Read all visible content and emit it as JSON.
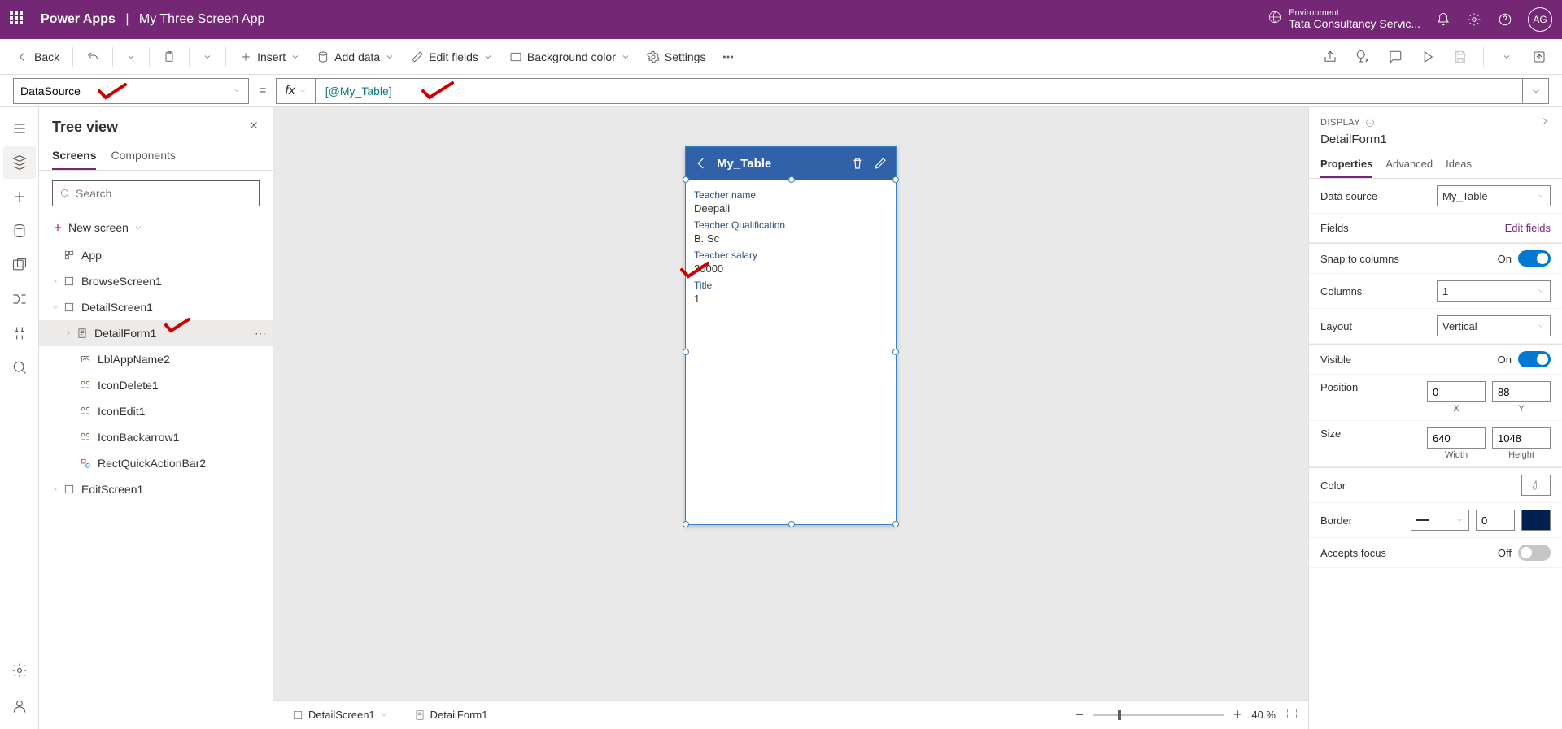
{
  "header": {
    "product": "Power Apps",
    "app_name": "My Three Screen App",
    "env_label": "Environment",
    "env_name": "Tata Consultancy Servic...",
    "avatar": "AG"
  },
  "cmdbar": {
    "back": "Back",
    "insert": "Insert",
    "add_data": "Add data",
    "edit_fields": "Edit fields",
    "bg_color": "Background color",
    "settings": "Settings"
  },
  "formula": {
    "property": "DataSource",
    "expression": "[@My_Table]"
  },
  "tree": {
    "title": "Tree view",
    "tab_screens": "Screens",
    "tab_components": "Components",
    "search_placeholder": "Search",
    "new_screen": "New screen",
    "app": "App",
    "browse": "BrowseScreen1",
    "detail": "DetailScreen1",
    "detailform": "DetailForm1",
    "lbl": "LblAppName2",
    "icondelete": "IconDelete1",
    "iconedit": "IconEdit1",
    "iconback": "IconBackarrow1",
    "rect": "RectQuickActionBar2",
    "edit": "EditScreen1"
  },
  "phone": {
    "title": "My_Table",
    "f1l": "Teacher name",
    "f1v": "Deepali",
    "f2l": "Teacher Qualification",
    "f2v": "B. Sc",
    "f3l": "Teacher salary",
    "f3v": "30000",
    "f4l": "Title",
    "f4v": "1"
  },
  "status": {
    "crumb1": "DetailScreen1",
    "crumb2": "DetailForm1",
    "zoom": "40  %"
  },
  "props": {
    "display": "DISPLAY",
    "name": "DetailForm1",
    "tab_props": "Properties",
    "tab_adv": "Advanced",
    "tab_ideas": "Ideas",
    "data_source_lbl": "Data source",
    "data_source_val": "My_Table",
    "fields_lbl": "Fields",
    "edit_fields": "Edit fields",
    "snap_lbl": "Snap to columns",
    "snap_val": "On",
    "columns_lbl": "Columns",
    "columns_val": "1",
    "layout_lbl": "Layout",
    "layout_val": "Vertical",
    "visible_lbl": "Visible",
    "visible_val": "On",
    "position_lbl": "Position",
    "pos_x": "0",
    "pos_y": "88",
    "x": "X",
    "y": "Y",
    "size_lbl": "Size",
    "size_w": "640",
    "size_h": "1048",
    "w": "Width",
    "h": "Height",
    "color_lbl": "Color",
    "border_lbl": "Border",
    "border_val": "0",
    "accepts_lbl": "Accepts focus",
    "accepts_val": "Off"
  }
}
